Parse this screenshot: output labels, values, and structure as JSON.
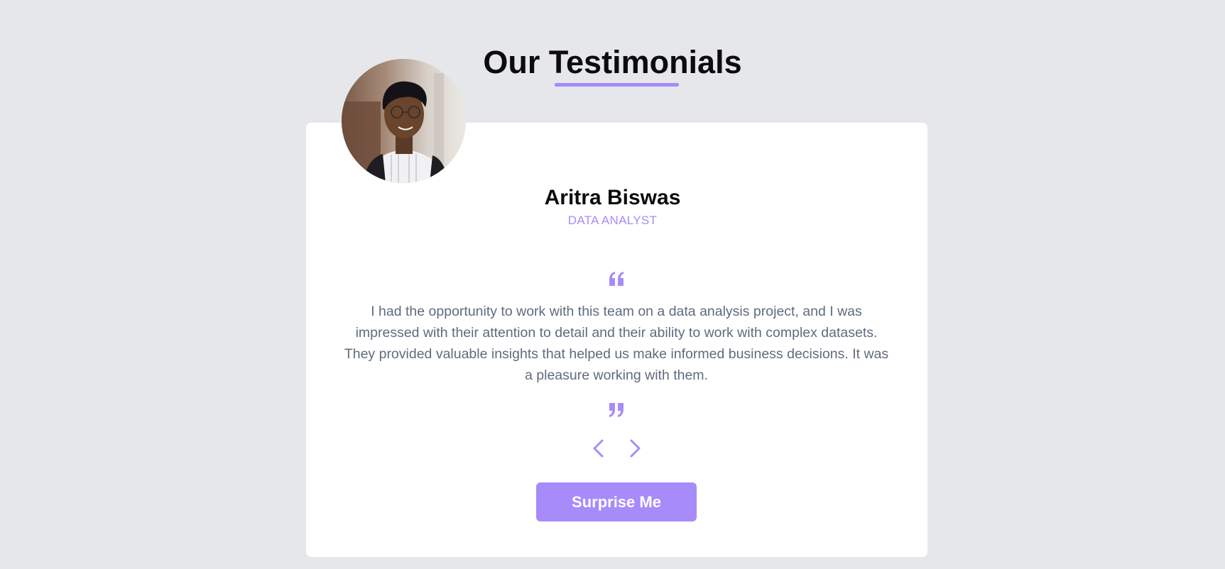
{
  "header": {
    "title": "Our Testimonials"
  },
  "testimonial": {
    "name": "Aritra Biswas",
    "job": "DATA ANALYST",
    "text": "I had the opportunity to work with this team on a data analysis project, and I was impressed with their attention to detail and their ability to work with complex datasets. They provided valuable insights that helped us make informed business decisions. It was a pleasure working with them.",
    "avatar_icon": "person-photo"
  },
  "controls": {
    "prev_icon": "chevron-left-icon",
    "next_icon": "chevron-right-icon",
    "surprise_label": "Surprise Me"
  },
  "colors": {
    "accent": "#a78bfa",
    "background": "#e6e7eb",
    "card": "#ffffff",
    "text": "#5f6b7e",
    "heading": "#0c0c0f"
  }
}
